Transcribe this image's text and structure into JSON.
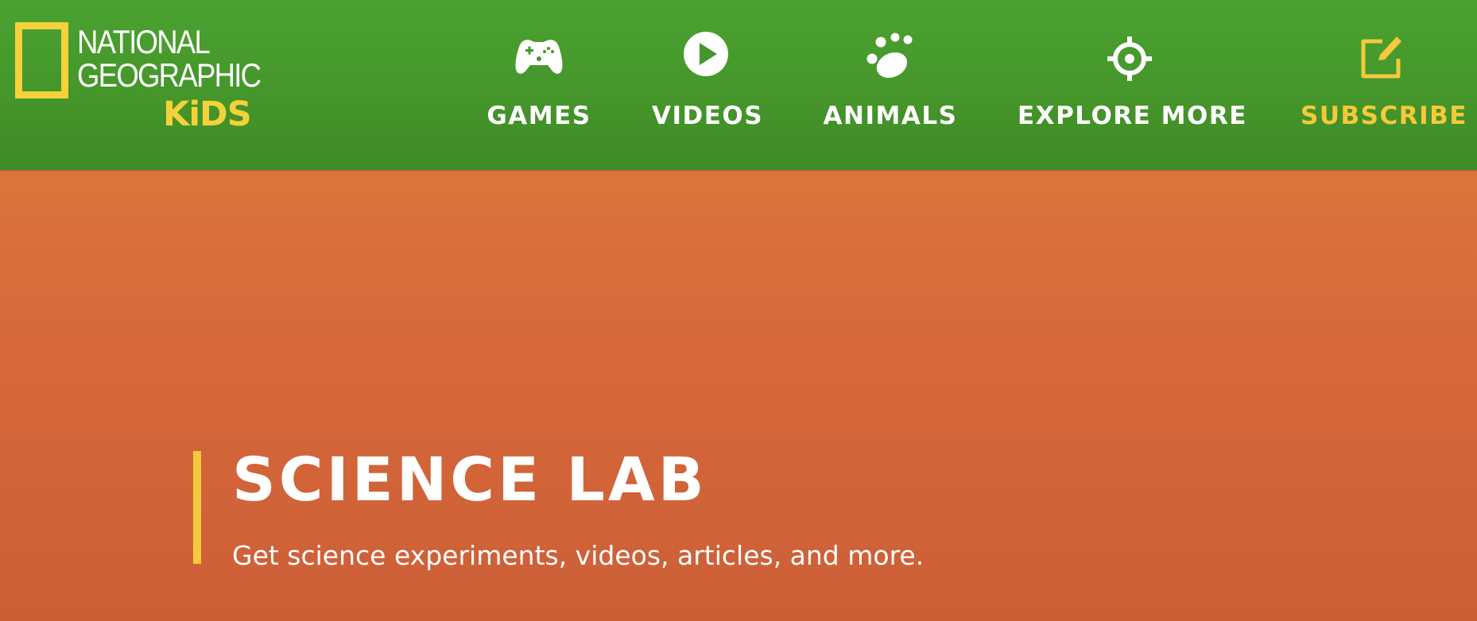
{
  "header": {
    "logo": {
      "line1": "NATIONAL",
      "line2": "GEOGRAPHIC",
      "kids": "KiDS"
    },
    "nav": [
      {
        "label": "GAMES",
        "icon": "gamepad-icon"
      },
      {
        "label": "VIDEOS",
        "icon": "play-icon"
      },
      {
        "label": "ANIMALS",
        "icon": "paw-icon"
      },
      {
        "label": "EXPLORE MORE",
        "icon": "crosshair-icon"
      },
      {
        "label": "SUBSCRIBE",
        "icon": "edit-icon"
      }
    ]
  },
  "hero": {
    "title": "SCIENCE LAB",
    "subtitle": "Get science experiments, videos, articles, and more."
  },
  "colors": {
    "header_green": "#45962b",
    "background_orange": "#d9703c",
    "accent_yellow": "#f5c93b",
    "text_white": "#ffffff"
  }
}
